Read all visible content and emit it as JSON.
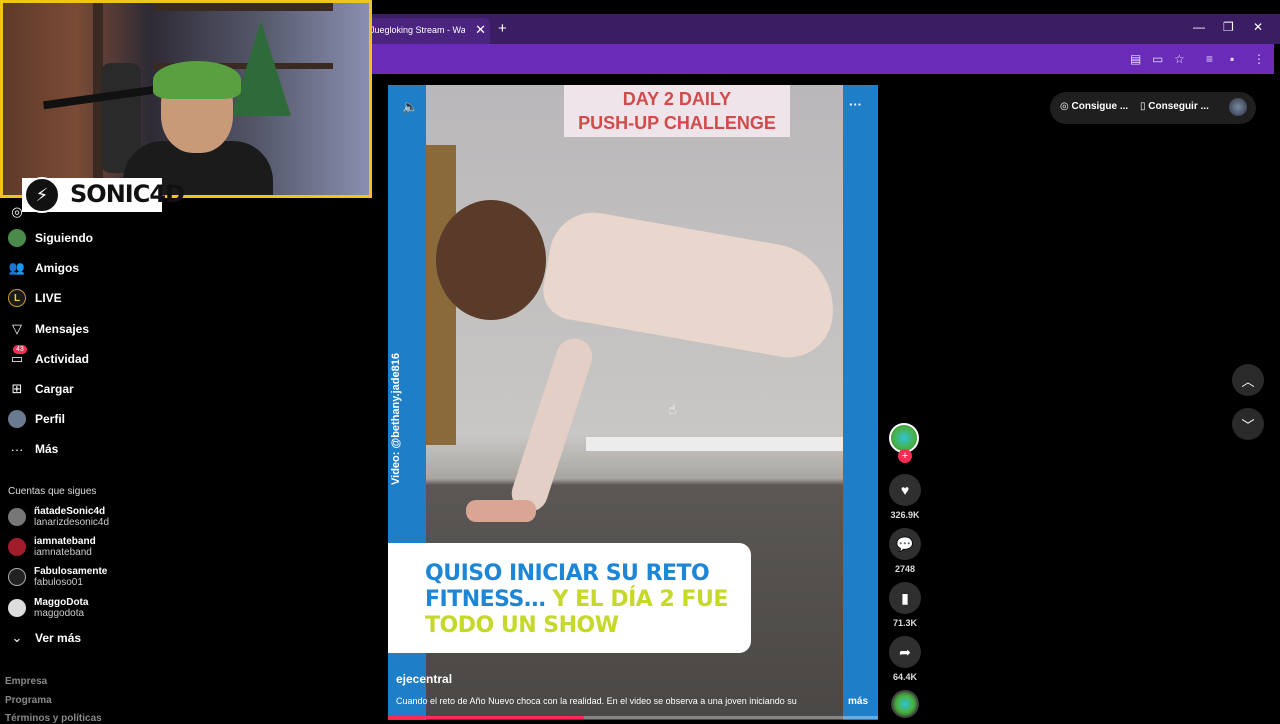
{
  "browser": {
    "tab_title": "Juegloking Stream - Watch Li",
    "tab_close": "✕",
    "new_tab": "+",
    "minimize": "—",
    "restore": "❐",
    "close": "✕"
  },
  "webcam": {
    "logo_text": "SONIC4D"
  },
  "sidebar": {
    "items": [
      {
        "label": "Siguiendo",
        "icon": "following-avatar-icon"
      },
      {
        "label": "Amigos",
        "icon": "friends-icon"
      },
      {
        "label": "LIVE",
        "icon": "live-icon"
      },
      {
        "label": "Mensajes",
        "icon": "messages-icon"
      },
      {
        "label": "Actividad",
        "icon": "activity-icon",
        "badge": "43"
      },
      {
        "label": "Cargar",
        "icon": "upload-icon"
      },
      {
        "label": "Perfil",
        "icon": "profile-avatar-icon"
      },
      {
        "label": "Más",
        "icon": "more-icon"
      }
    ],
    "section_title": "Cuentas que sigues",
    "following": [
      {
        "name": "ñatadeSonic4d",
        "user": "lanarizdesonic4d"
      },
      {
        "name": "iamnateband",
        "user": "iamnateband"
      },
      {
        "name": "Fabulosamente",
        "user": "fabuloso01"
      },
      {
        "name": "MaggoDota",
        "user": "maggodota"
      }
    ],
    "see_more": "Ver más",
    "footer": [
      "Empresa",
      "Programa",
      "Términos y políticas"
    ]
  },
  "video": {
    "title_line1": "DAY 2 DAILY",
    "title_line2": "PUSH-UP CHALLENGE",
    "credit": "Video: @bethany.jade816",
    "caption_line1": "QUISO INICIAR SU RETO",
    "caption_line2a": "FITNESS… ",
    "caption_line2b": "Y EL DÍA 2 FUE",
    "caption_line3": "TODO UN SHOW",
    "author": "ejecentral",
    "description": "Cuando el reto de Año Nuevo choca con la realidad. En el video se observa a una joven iniciando su",
    "more": "más",
    "progress": 0.4
  },
  "actions": {
    "likes": "326.9K",
    "comments": "2748",
    "saves": "71.3K",
    "shares": "64.4K"
  },
  "top_right": {
    "btn1": "Consigue ...",
    "btn2": "Conseguir ..."
  },
  "colors": {
    "accent": "#fe2c55",
    "browser_purple": "#6a2bb8",
    "caption_blue": "#1d86d6",
    "caption_yellow": "#c6d82a"
  }
}
